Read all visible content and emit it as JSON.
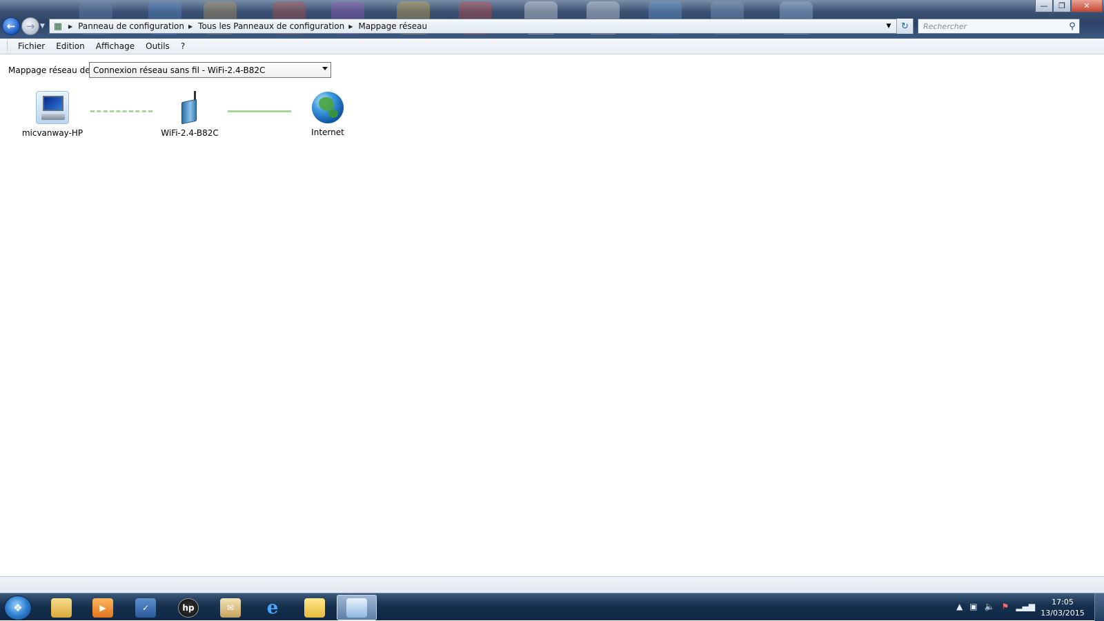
{
  "address_bar": {
    "breadcrumbs": [
      "Panneau de configuration",
      "Tous les Panneaux de configuration",
      "Mappage réseau"
    ],
    "icon": "control-panel-icon"
  },
  "search": {
    "placeholder": "Rechercher"
  },
  "menu": [
    "Fichier",
    "Edition",
    "Affichage",
    "Outils",
    "?"
  ],
  "map": {
    "label": "Mappage réseau de",
    "selected_connection": "Connexion réseau sans fil - WiFi-2.4-B82C",
    "nodes": [
      {
        "name": "micvanway-HP",
        "icon": "computer-icon"
      },
      {
        "name": "WiFi-2.4-B82C",
        "icon": "wireless-router-icon"
      },
      {
        "name": "Internet",
        "icon": "globe-icon"
      }
    ],
    "link_colors": {
      "wireless": "#a7d59a",
      "wired": "#a7d59a"
    }
  },
  "taskbar": {
    "pinned": [
      "explorer-icon",
      "media-player-icon",
      "wave-app-icon",
      "hp-icon",
      "mail-icon",
      "internet-explorer-icon",
      "sticky-notes-icon",
      "network-map-icon"
    ],
    "tray": [
      "show-hidden-icons",
      "network-status-icon",
      "volume-icon",
      "action-center-flag-icon",
      "signal-icon"
    ],
    "time": "17:05",
    "date": "13/03/2015"
  },
  "colors": {
    "accent": "#1d5bc4",
    "taskbar": "#16304f"
  }
}
